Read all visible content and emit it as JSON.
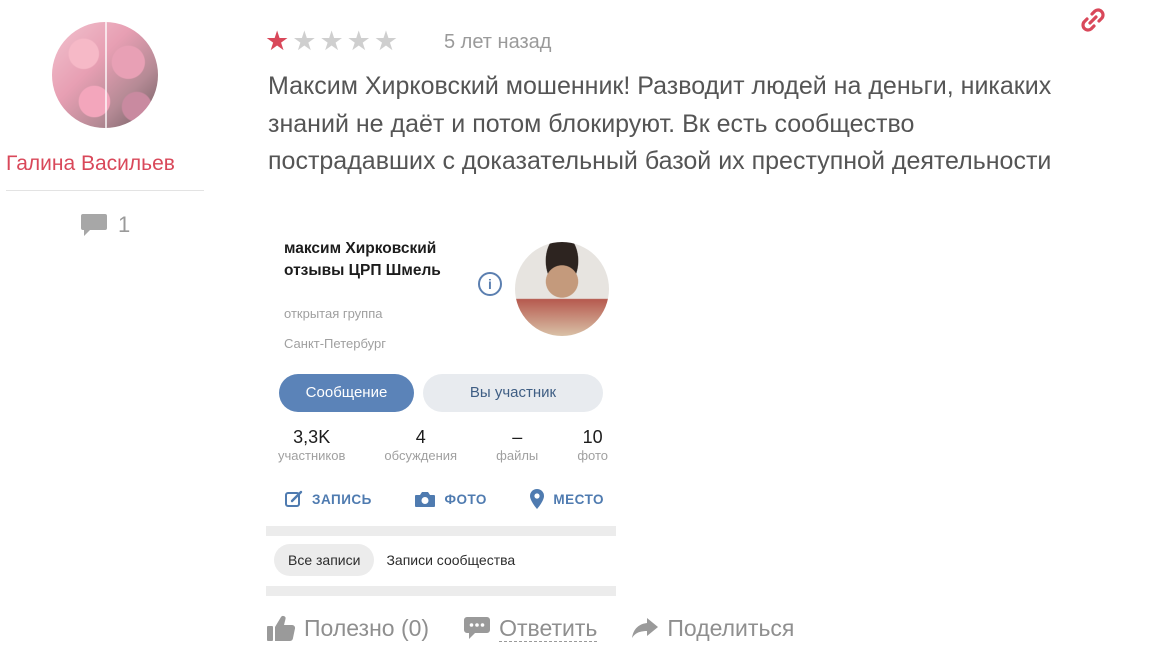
{
  "author": {
    "name": "Галина Васильев",
    "reviews_count": "1"
  },
  "review": {
    "rating": 1,
    "max_rating": 5,
    "date": "5 лет назад",
    "text": "Максим Хирковский мошенник! Разводит людей на деньги, никаких знаний не даёт и потом блокируют. Вк есть сообщество пострадавших с доказательный базой их преступной деятельности"
  },
  "embedded_screenshot": {
    "group_title": "максим Хирковский отзывы ЦРП Шмель",
    "group_type": "открытая группа",
    "city": "Санкт-Петербург",
    "message_button": "Сообщение",
    "member_button": "Вы участник",
    "stats": [
      {
        "value": "3,3K",
        "label": "участников"
      },
      {
        "value": "4",
        "label": "обсуждения"
      },
      {
        "value": "–",
        "label": "файлы"
      },
      {
        "value": "10",
        "label": "фото"
      }
    ],
    "actions": {
      "post": "ЗАПИСЬ",
      "photo": "ФОТО",
      "place": "МЕСТО"
    },
    "tabs": {
      "all": "Все записи",
      "community": "Записи сообщества"
    }
  },
  "footer": {
    "useful": "Полезно (0)",
    "reply": "Ответить",
    "share": "Поделиться"
  },
  "colors": {
    "accent": "#d9485a",
    "star_empty": "#cfcfcf",
    "vk_blue": "#5b83b8"
  }
}
